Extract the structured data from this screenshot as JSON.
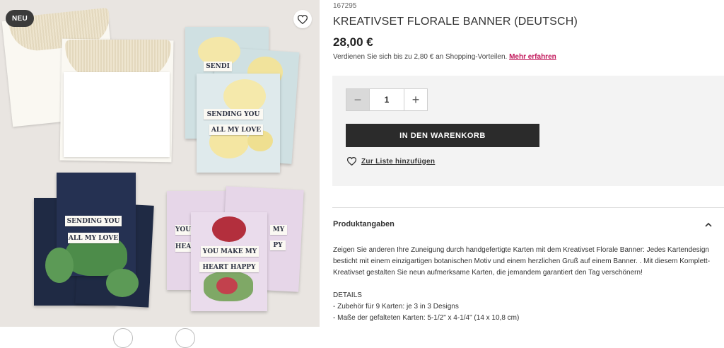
{
  "gallery": {
    "badge": "NEU",
    "cards": {
      "sending_line1": "SENDING YOU",
      "sending_line2": "ALL MY LOVE",
      "heart_line1": "YOU MAKE MY",
      "heart_line2": "HEART HAPPY",
      "partial_top": "SENDI",
      "partial_left": "YOU",
      "partial_left2": "HEA",
      "partial_right": "MY",
      "partial_right2": "PY"
    }
  },
  "product": {
    "sku": "167295",
    "title": "KREATIVSET FLORALE BANNER (DEUTSCH)",
    "price": "28,00 €",
    "earn_text": "Verdienen Sie sich bis zu 2,80 € an Shopping-Vorteilen.",
    "earn_link": "Mehr erfahren",
    "quantity": "1",
    "minus_label": "−",
    "plus_label": "+",
    "cart_label": "IN DEN WARENKORB",
    "wishlist_label": "Zur Liste hinzufügen"
  },
  "details": {
    "section_title": "Produktangaben",
    "description_1": "Zeigen Sie anderen Ihre Zuneigung durch handgefertigte Karten mit dem Kreativset Florale Banner: Jedes Kartendesign besticht mit einem einzigartigen botanischen Motiv und einem herzlichen Gruß auf einem Banner. . Mit diesem Komplett-Kreativset gestalten Sie neun aufmerksame Karten, die jemandem garantiert den Tag verschönern!",
    "details_heading": "DETAILS",
    "details_1": "- Zubehör für 9 Karten: je 3 in 3 Designs",
    "details_2": "- Maße der gefalteten Karten: 5-1/2\" x 4-1/4\" (14 x 10,8 cm)"
  },
  "colors": {
    "accent_link": "#c2185b",
    "cart_button": "#2b2b2b",
    "buy_box": "#f3f3f3"
  }
}
